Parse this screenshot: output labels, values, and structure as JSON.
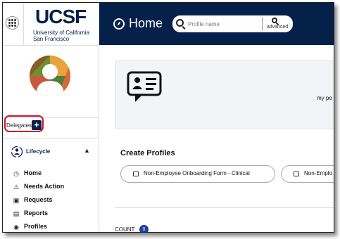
{
  "brand": {
    "logo": "UCSF",
    "subtitle_line1": "University of California",
    "subtitle_line2": "San Francisco",
    "navy": "#052049"
  },
  "header": {
    "title": "Home",
    "home_icon": "dashboard-icon"
  },
  "search": {
    "placeholder": "Profile name",
    "advanced_label": "advanced",
    "icon": "search-icon"
  },
  "sidebar": {
    "delegates_label": "Delegates",
    "delegates_add": "+",
    "lifecycle_label": "Lifecycle",
    "nav": [
      {
        "label": "Home",
        "icon": "dashboard-icon",
        "glyph": "◷"
      },
      {
        "label": "Needs Action",
        "icon": "warning-icon",
        "glyph": "⚠"
      },
      {
        "label": "Requests",
        "icon": "id-card-icon",
        "glyph": "▣"
      },
      {
        "label": "Reports",
        "icon": "document-icon",
        "glyph": "▤"
      },
      {
        "label": "Profiles",
        "icon": "profiles-icon",
        "glyph": "◉"
      }
    ]
  },
  "banner": {
    "text": "my pe"
  },
  "create_profiles": {
    "title": "Create Profiles",
    "forms": [
      {
        "label": "Non-Employee Onboarding Form - Clinical"
      },
      {
        "label": "Non-Emplo"
      }
    ]
  },
  "count": {
    "label": "COUNT",
    "value": "0",
    "badge_color": "#1a3fa0"
  },
  "highlight_color": "#d51226"
}
